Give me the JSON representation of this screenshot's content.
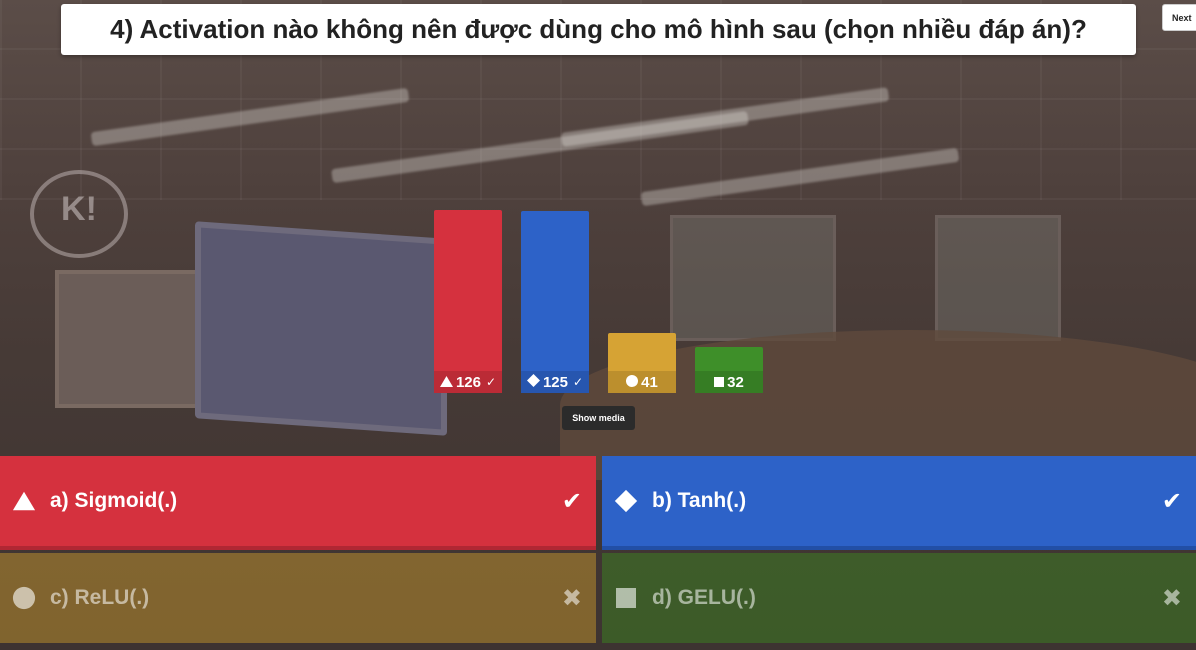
{
  "question": {
    "text": "4) Activation nào không nên được dùng cho mô hình sau (chọn nhiều đáp án)?"
  },
  "controls": {
    "next_label": "Next",
    "show_media_label": "Show media"
  },
  "background": {
    "logo_text": "K!"
  },
  "chart_data": {
    "type": "bar",
    "categories": [
      "triangle",
      "diamond",
      "circle",
      "square"
    ],
    "values": [
      126,
      125,
      41,
      32
    ],
    "correct": [
      true,
      true,
      false,
      false
    ],
    "colors": [
      "#d5313e",
      "#2d62c8",
      "#d6a334",
      "#3e8f29"
    ],
    "title": "",
    "xlabel": "",
    "ylabel": ""
  },
  "answers": [
    {
      "key": "a",
      "label": "a) Sigmoid(.)",
      "icon": "triangle-icon",
      "correct": true,
      "color": "#d5313e"
    },
    {
      "key": "b",
      "label": "b) Tanh(.)",
      "icon": "diamond-icon",
      "correct": true,
      "color": "#2d62c8"
    },
    {
      "key": "c",
      "label": "c) ReLU(.)",
      "icon": "circle-icon",
      "correct": false,
      "color": "#d6a334"
    },
    {
      "key": "d",
      "label": "d) GELU(.)",
      "icon": "square-icon",
      "correct": false,
      "color": "#3e8f29"
    }
  ],
  "marks": {
    "correct_icon": "check-icon",
    "incorrect_icon": "cross-icon"
  }
}
